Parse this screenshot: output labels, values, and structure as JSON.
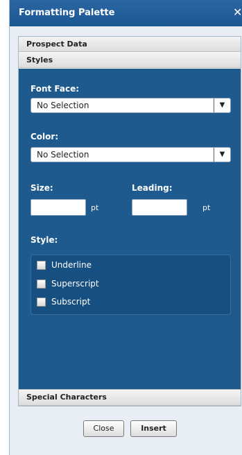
{
  "window": {
    "title": "Formatting Palette",
    "close_glyph": "✕"
  },
  "accordion": {
    "prospect_data": "Prospect Data",
    "styles": "Styles",
    "special_characters": "Special Characters"
  },
  "styles_panel": {
    "font_face": {
      "label": "Font Face:",
      "value": "No Selection"
    },
    "color": {
      "label": "Color:",
      "value": "No Selection"
    },
    "size": {
      "label": "Size:",
      "value": "",
      "unit": "pt"
    },
    "leading": {
      "label": "Leading:",
      "value": "",
      "unit": "pt"
    },
    "style": {
      "label": "Style:",
      "options": [
        {
          "label": "Underline",
          "checked": false
        },
        {
          "label": "Superscript",
          "checked": false
        },
        {
          "label": "Subscript",
          "checked": false
        }
      ]
    }
  },
  "buttons": {
    "close": "Close",
    "insert": "Insert"
  },
  "icons": {
    "close": "close-icon",
    "dropdown": "chevron-down-icon"
  },
  "colors": {
    "titlebar": "#1f5c99",
    "panel_body": "#1e5a8e",
    "window_bg": "#e9eef4"
  }
}
